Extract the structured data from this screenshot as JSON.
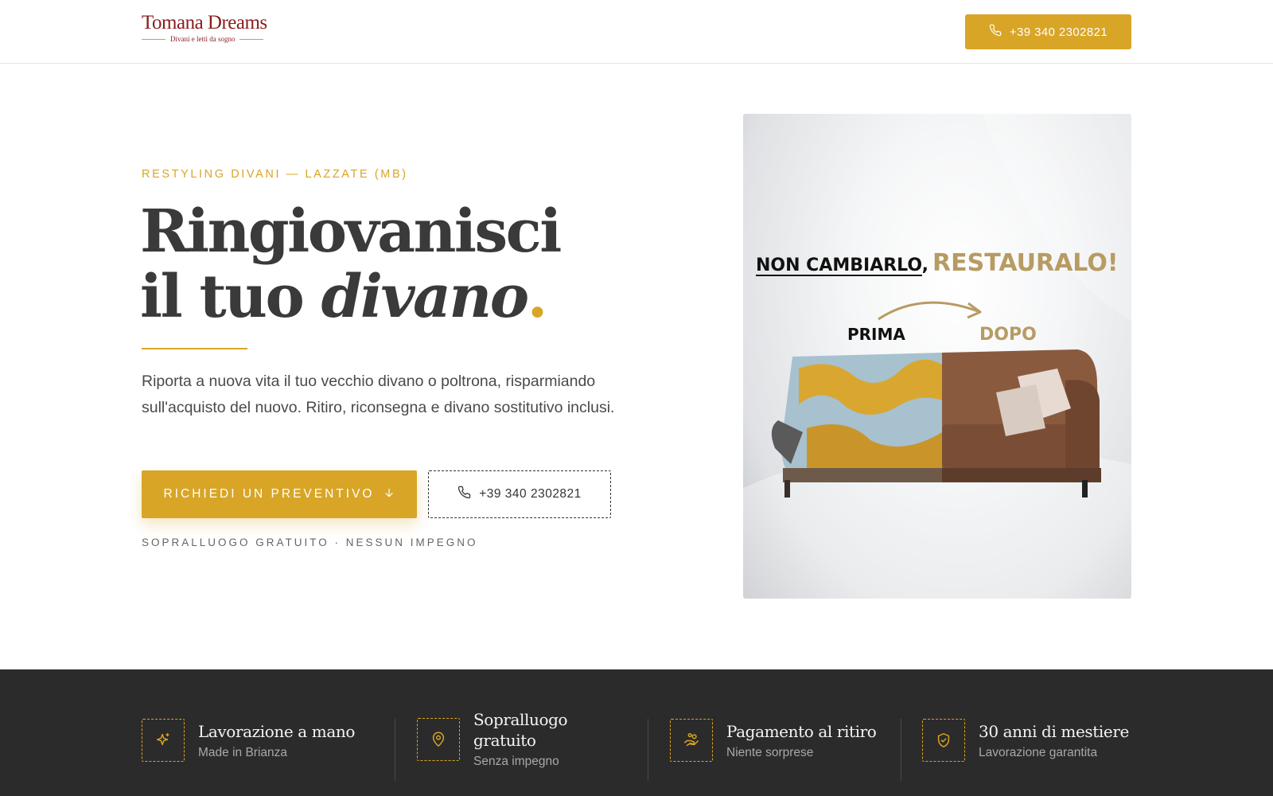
{
  "header": {
    "logo_text": "Tomana Dreams",
    "logo_tagline": "Divani e letti da sogno",
    "phone_label": "+39 340 2302821"
  },
  "hero": {
    "kicker": "RESTYLING DIVANI — LAZZATE (MB)",
    "title_line1": "Ringiovanisci",
    "title_line2_prefix": "il tuo ",
    "title_line2_italic": "divano",
    "title_dot": ".",
    "description": "Riporta a nuova vita il tuo vecchio divano o poltrona, risparmiando sull'acquisto del nuovo. Ritiro, riconsegna e divano sostitutivo inclusi.",
    "cta_primary": "RICHIEDI UN PREVENTIVO",
    "cta_secondary": "+39 340 2302821",
    "fineprint": "SOPRALLUOGO GRATUITO · NESSUN IMPEGNO"
  },
  "hero_image": {
    "headline_part1": "NON CAMBIARLO,",
    "headline_part2": "RESTAURALO!",
    "label_before": "PRIMA",
    "label_after": "DOPO"
  },
  "features": [
    {
      "title": "Lavorazione a mano",
      "subtitle": "Made in Brianza",
      "icon": "sparkle-icon"
    },
    {
      "title": "Sopralluogo gratuito",
      "subtitle": "Senza impegno",
      "icon": "map-pin-icon"
    },
    {
      "title": "Pagamento al ritiro",
      "subtitle": "Niente sorprese",
      "icon": "hand-coins-icon"
    },
    {
      "title": "30 anni di mestiere",
      "subtitle": "Lavorazione garantita",
      "icon": "shield-check-icon"
    }
  ],
  "colors": {
    "accent": "#d8a526",
    "dark_band": "#2b2b2b",
    "logo_red": "#8a1d1d",
    "text": "#3a3a3a"
  }
}
